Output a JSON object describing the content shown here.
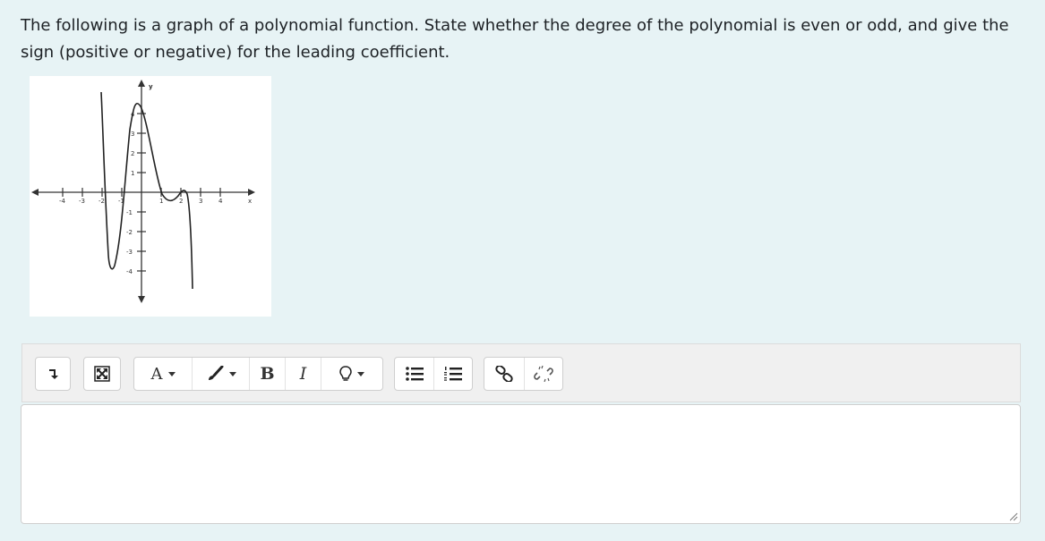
{
  "question": {
    "text": "The following is a graph of a polynomial function. State whether the degree of the polynomial is even or odd, and give the sign (positive or negative) for the leading coefficient."
  },
  "graph": {
    "y_axis_label": "y",
    "x_axis_label": "x",
    "x_tick_labels": [
      "-4",
      "-3",
      "-2",
      "-1",
      "1",
      "2",
      "3",
      "4"
    ],
    "y_tick_labels": [
      "4",
      "3",
      "2",
      "1",
      "-1",
      "-2",
      "-3",
      "-4"
    ]
  },
  "toolbar": {
    "font_button_label": "A",
    "bold_label": "B",
    "italic_label": "I"
  },
  "editor": {
    "value": ""
  }
}
